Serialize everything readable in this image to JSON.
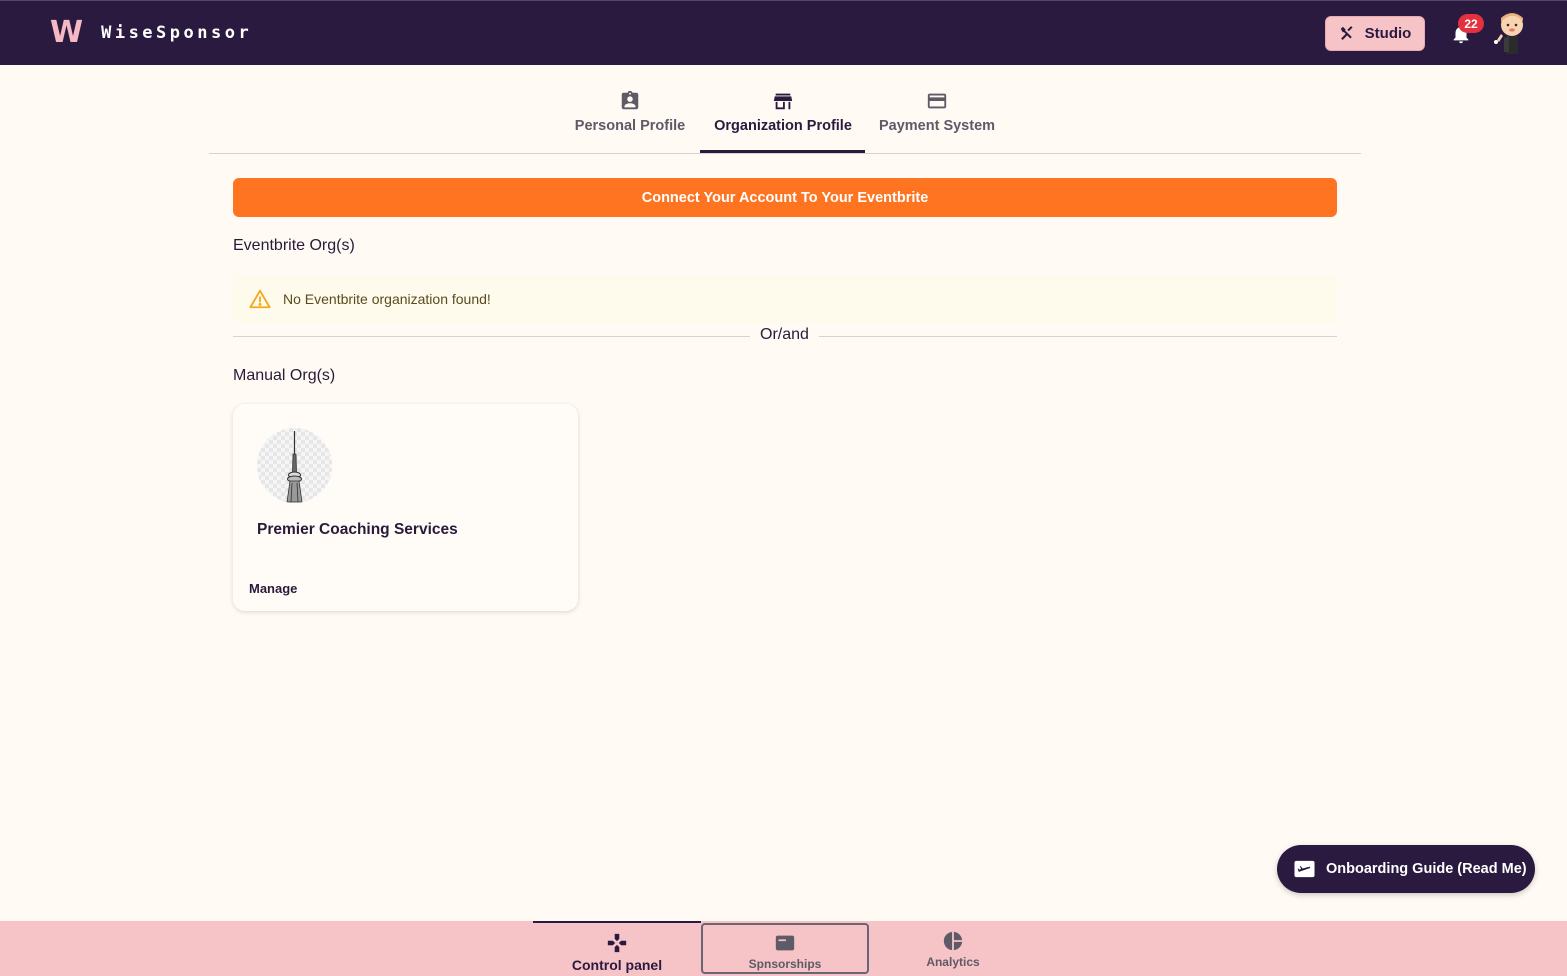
{
  "header": {
    "logo_mark": "W",
    "app_name": "WiseSponsor",
    "studio_label": "Studio",
    "notification_count": "22"
  },
  "tabs": [
    {
      "label": "Personal Profile",
      "icon": "id-badge-icon",
      "active": false
    },
    {
      "label": "Organization Profile",
      "icon": "storefront-icon",
      "active": true
    },
    {
      "label": "Payment System",
      "icon": "credit-card-icon",
      "active": false
    }
  ],
  "main": {
    "connect_button": "Connect Your Account To Your Eventbrite",
    "eventbrite_title": "Eventbrite Org(s)",
    "alert_text": "No Eventbrite organization found!",
    "divider_text": "Or/and",
    "manual_title": "Manual Org(s)",
    "orgs": [
      {
        "name": "Premier Coaching Services",
        "manage_label": "Manage"
      }
    ]
  },
  "onboarding_label": "Onboarding Guide (Read Me)",
  "bottom_nav": [
    {
      "label": "Control panel",
      "icon": "gamepad-icon",
      "active": true
    },
    {
      "label": "Spnsorships",
      "icon": "card-icon",
      "active": false
    },
    {
      "label": "Analytics",
      "icon": "pie-chart-icon",
      "active": false
    }
  ],
  "colors": {
    "brand_dark": "#2a1a3f",
    "accent_orange": "#ff7420",
    "pink": "#f6c3c6",
    "background": "#fffaf3",
    "badge_red": "#e5313d"
  }
}
